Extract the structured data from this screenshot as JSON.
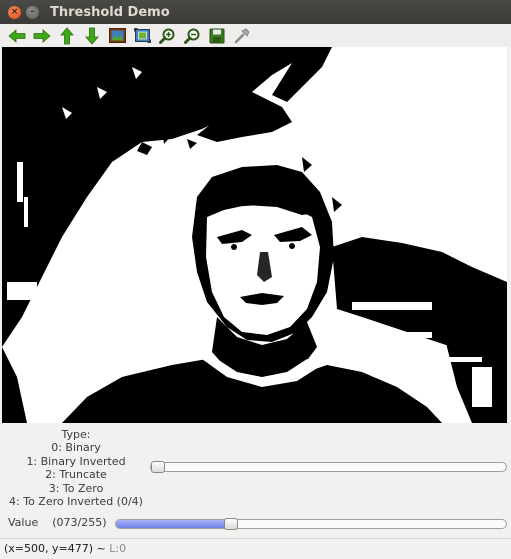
{
  "window": {
    "title": "Threshold Demo"
  },
  "toolbar": {
    "icons": [
      "arrow-left-icon",
      "arrow-right-icon",
      "arrow-up-icon",
      "arrow-down-icon",
      "image-icon",
      "fit-icon",
      "zoom-in-icon",
      "zoom-out-icon",
      "save-icon",
      "properties-icon"
    ]
  },
  "type_control": {
    "lines": [
      "Type:",
      "0: Binary",
      "1: Binary Inverted",
      "2: Truncate",
      "3: To Zero",
      "4: To Zero Inverted (0/4)"
    ],
    "value": 0,
    "max": 4
  },
  "value_control": {
    "label": "Value",
    "readout": "(073/255)",
    "value": 73,
    "max": 255
  },
  "status": {
    "coords": "(x=500, y=477) ~",
    "level": "L:0"
  },
  "colors": {
    "slider_fill": "#7b8fec",
    "title_bar": "#3c3b37"
  }
}
